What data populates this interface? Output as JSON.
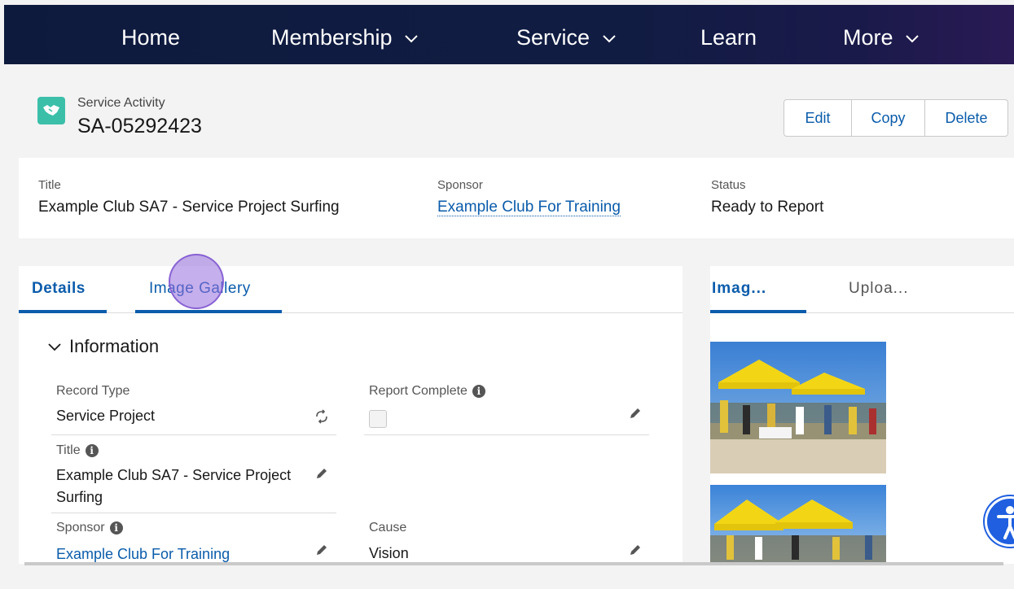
{
  "nav": {
    "items": [
      {
        "label": "Home",
        "dropdown": false
      },
      {
        "label": "Membership",
        "dropdown": true
      },
      {
        "label": "Service",
        "dropdown": true
      },
      {
        "label": "Learn",
        "dropdown": false
      },
      {
        "label": "More",
        "dropdown": true
      }
    ]
  },
  "record": {
    "object_type": "Service Activity",
    "name": "SA-05292423",
    "icon": "handshake-icon",
    "accent": "#3bbfa9"
  },
  "actions": {
    "edit": "Edit",
    "copy": "Copy",
    "delete": "Delete"
  },
  "highlights": {
    "title_label": "Title",
    "title_value": "Example Club SA7 - Service Project Surfing",
    "sponsor_label": "Sponsor",
    "sponsor_value": "Example Club For Training",
    "status_label": "Status",
    "status_value": "Ready to Report"
  },
  "detail_tabs": {
    "details": "Details",
    "gallery": "Image Gallery"
  },
  "information": {
    "section_title": "Information",
    "record_type_label": "Record Type",
    "record_type_value": "Service Project",
    "report_complete_label": "Report Complete",
    "report_complete_checked": false,
    "title_label": "Title",
    "title_value_line1": "Example Club SA7 - Service Project",
    "title_value_line2": "Surfing",
    "sponsor_label": "Sponsor",
    "sponsor_value": "Example Club For Training",
    "cause_label": "Cause",
    "cause_value": "Vision"
  },
  "side_tabs": {
    "images": "Imag...",
    "upload": "Uploa..."
  },
  "colors": {
    "link": "#0b5cab",
    "nav_bg": "#0e1a3d"
  }
}
